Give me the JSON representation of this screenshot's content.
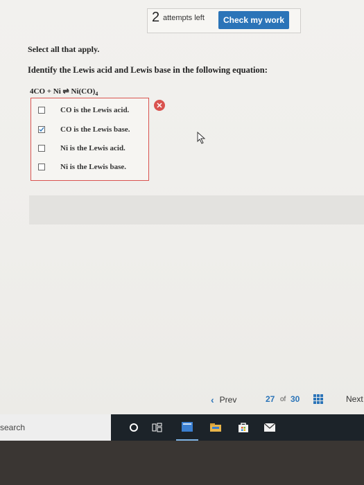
{
  "header": {
    "attempts_count": "2",
    "attempts_label": "attempts left",
    "check_button": "Check my work"
  },
  "question": {
    "instruction": "Select all that apply.",
    "prompt": "Identify the Lewis acid and Lewis base in the following equation:",
    "equation": {
      "lhs": "4CO + Ni",
      "arrow": "⇌",
      "rhs": "Ni(CO)",
      "subscript": "4"
    },
    "options": [
      {
        "label": "CO is the Lewis acid.",
        "checked": false
      },
      {
        "label": "CO is the Lewis base.",
        "checked": true
      },
      {
        "label": "Ni is the Lewis acid.",
        "checked": false
      },
      {
        "label": "Ni is the Lewis base.",
        "checked": false
      }
    ],
    "status_icon": "x-icon",
    "status": "incorrect"
  },
  "pagination": {
    "prev_label": "Prev",
    "current": "27",
    "of": "of",
    "total": "30",
    "next_label": "Next"
  },
  "taskbar": {
    "search_text": "search",
    "icons": [
      "cortana-circle-icon",
      "task-view-icon",
      "edge-icon",
      "file-explorer-icon",
      "store-icon",
      "mail-icon"
    ]
  },
  "colors": {
    "accent": "#2b74b8",
    "error": "#d9534f",
    "taskbar": "#1c2329"
  }
}
